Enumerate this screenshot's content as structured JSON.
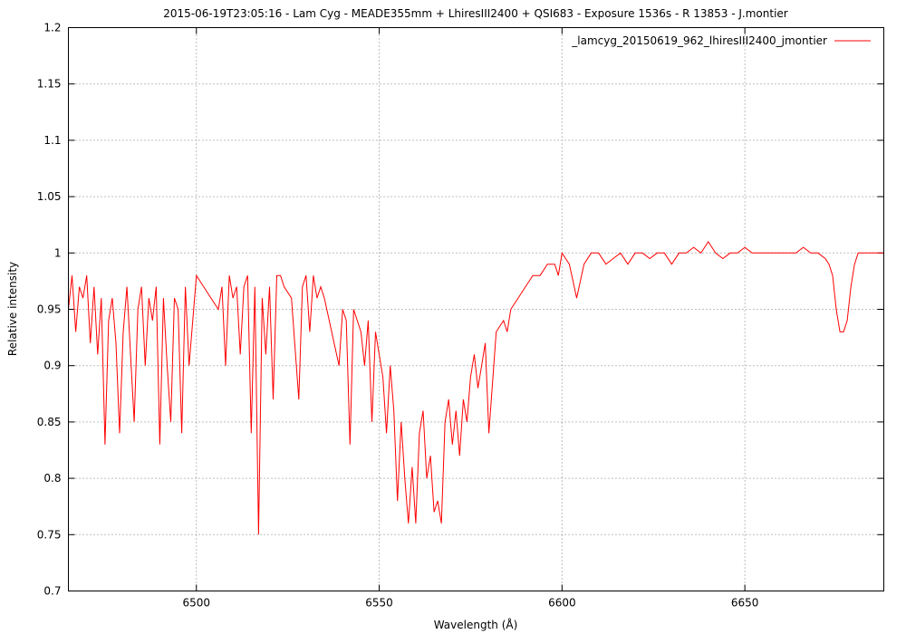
{
  "chart_data": {
    "type": "line",
    "title": "2015-06-19T23:05:16 - Lam Cyg - MEADE355mm + LhiresIII2400 + QSI683 - Exposure 1536s - R 13853 - J.montier",
    "xlabel": "Wavelength (Å)",
    "ylabel": "Relative intensity",
    "xlim": [
      6465,
      6688
    ],
    "ylim": [
      0.7,
      1.2
    ],
    "grid": true,
    "legend_position": "top-right",
    "x_ticks": [
      6500,
      6550,
      6600,
      6650
    ],
    "x_tick_labels": [
      "6500",
      "6550",
      "6600",
      "6650"
    ],
    "y_ticks": [
      0.7,
      0.75,
      0.8,
      0.85,
      0.9,
      0.95,
      1,
      1.05,
      1.1,
      1.15,
      1.2
    ],
    "y_tick_labels": [
      "0.7",
      "0.75",
      "0.8",
      "0.85",
      "0.9",
      "0.95",
      "1",
      "1.05",
      "1.1",
      "1.15",
      "1.2"
    ],
    "series": [
      {
        "name": "_lamcyg_20150619_962_lhiresIII2400_jmontier",
        "color": "#ff0000",
        "x": [
          6465,
          6466,
          6467,
          6468,
          6469,
          6470,
          6471,
          6472,
          6473,
          6474,
          6475,
          6476,
          6477,
          6478,
          6479,
          6480,
          6481,
          6482,
          6483,
          6484,
          6485,
          6486,
          6487,
          6488,
          6489,
          6490,
          6491,
          6492,
          6493,
          6494,
          6495,
          6496,
          6497,
          6498,
          6500,
          6502,
          6504,
          6506,
          6507,
          6508,
          6509,
          6510,
          6511,
          6512,
          6513,
          6514,
          6515,
          6516,
          6517,
          6518,
          6519,
          6520,
          6521,
          6522,
          6523,
          6524,
          6526,
          6528,
          6529,
          6530,
          6531,
          6532,
          6533,
          6534,
          6535,
          6537,
          6539,
          6540,
          6541,
          6542,
          6543,
          6544,
          6545,
          6546,
          6547,
          6548,
          6549,
          6550,
          6551,
          6552,
          6553,
          6554,
          6555,
          6556,
          6557,
          6558,
          6559,
          6560,
          6561,
          6562,
          6563,
          6564,
          6565,
          6566,
          6567,
          6568,
          6569,
          6570,
          6571,
          6572,
          6573,
          6574,
          6575,
          6576,
          6577,
          6578,
          6579,
          6580,
          6582,
          6584,
          6585,
          6586,
          6588,
          6590,
          6592,
          6594,
          6596,
          6598,
          6599,
          6600,
          6602,
          6604,
          6606,
          6608,
          6610,
          6612,
          6614,
          6616,
          6618,
          6620,
          6622,
          6624,
          6626,
          6628,
          6630,
          6632,
          6634,
          6636,
          6638,
          6640,
          6642,
          6644,
          6646,
          6648,
          6650,
          6652,
          6654,
          6656,
          6658,
          6660,
          6662,
          6664,
          6666,
          6668,
          6670,
          6672,
          6673,
          6674,
          6675,
          6676,
          6677,
          6678,
          6679,
          6680,
          6681,
          6682,
          6684,
          6686,
          6688
        ],
        "y": [
          0.95,
          0.98,
          0.93,
          0.97,
          0.96,
          0.98,
          0.92,
          0.97,
          0.91,
          0.96,
          0.83,
          0.94,
          0.96,
          0.92,
          0.84,
          0.93,
          0.97,
          0.91,
          0.85,
          0.95,
          0.97,
          0.9,
          0.96,
          0.94,
          0.97,
          0.83,
          0.96,
          0.9,
          0.85,
          0.96,
          0.95,
          0.84,
          0.97,
          0.9,
          0.98,
          0.97,
          0.96,
          0.95,
          0.97,
          0.9,
          0.98,
          0.96,
          0.97,
          0.91,
          0.97,
          0.98,
          0.84,
          0.97,
          0.75,
          0.96,
          0.91,
          0.97,
          0.87,
          0.98,
          0.98,
          0.97,
          0.96,
          0.87,
          0.97,
          0.98,
          0.93,
          0.98,
          0.96,
          0.97,
          0.96,
          0.93,
          0.9,
          0.95,
          0.94,
          0.83,
          0.95,
          0.94,
          0.93,
          0.9,
          0.94,
          0.85,
          0.93,
          0.91,
          0.89,
          0.84,
          0.9,
          0.86,
          0.78,
          0.85,
          0.8,
          0.76,
          0.81,
          0.76,
          0.84,
          0.86,
          0.8,
          0.82,
          0.77,
          0.78,
          0.76,
          0.85,
          0.87,
          0.83,
          0.86,
          0.82,
          0.87,
          0.85,
          0.89,
          0.91,
          0.88,
          0.9,
          0.92,
          0.84,
          0.93,
          0.94,
          0.93,
          0.95,
          0.96,
          0.97,
          0.98,
          0.98,
          0.99,
          0.99,
          0.98,
          1.0,
          0.99,
          0.96,
          0.99,
          1.0,
          1.0,
          0.99,
          0.995,
          1.0,
          0.99,
          1.0,
          1.0,
          0.995,
          1.0,
          1.0,
          0.99,
          1.0,
          1.0,
          1.005,
          1.0,
          1.01,
          1.0,
          0.995,
          1.0,
          1.0,
          1.005,
          1.0,
          1.0,
          1.0,
          1.0,
          1.0,
          1.0,
          1.0,
          1.005,
          1.0,
          1.0,
          0.995,
          0.99,
          0.98,
          0.95,
          0.93,
          0.93,
          0.94,
          0.97,
          0.99,
          1.0,
          1.0,
          1.0,
          1.0,
          1.0
        ]
      }
    ]
  }
}
